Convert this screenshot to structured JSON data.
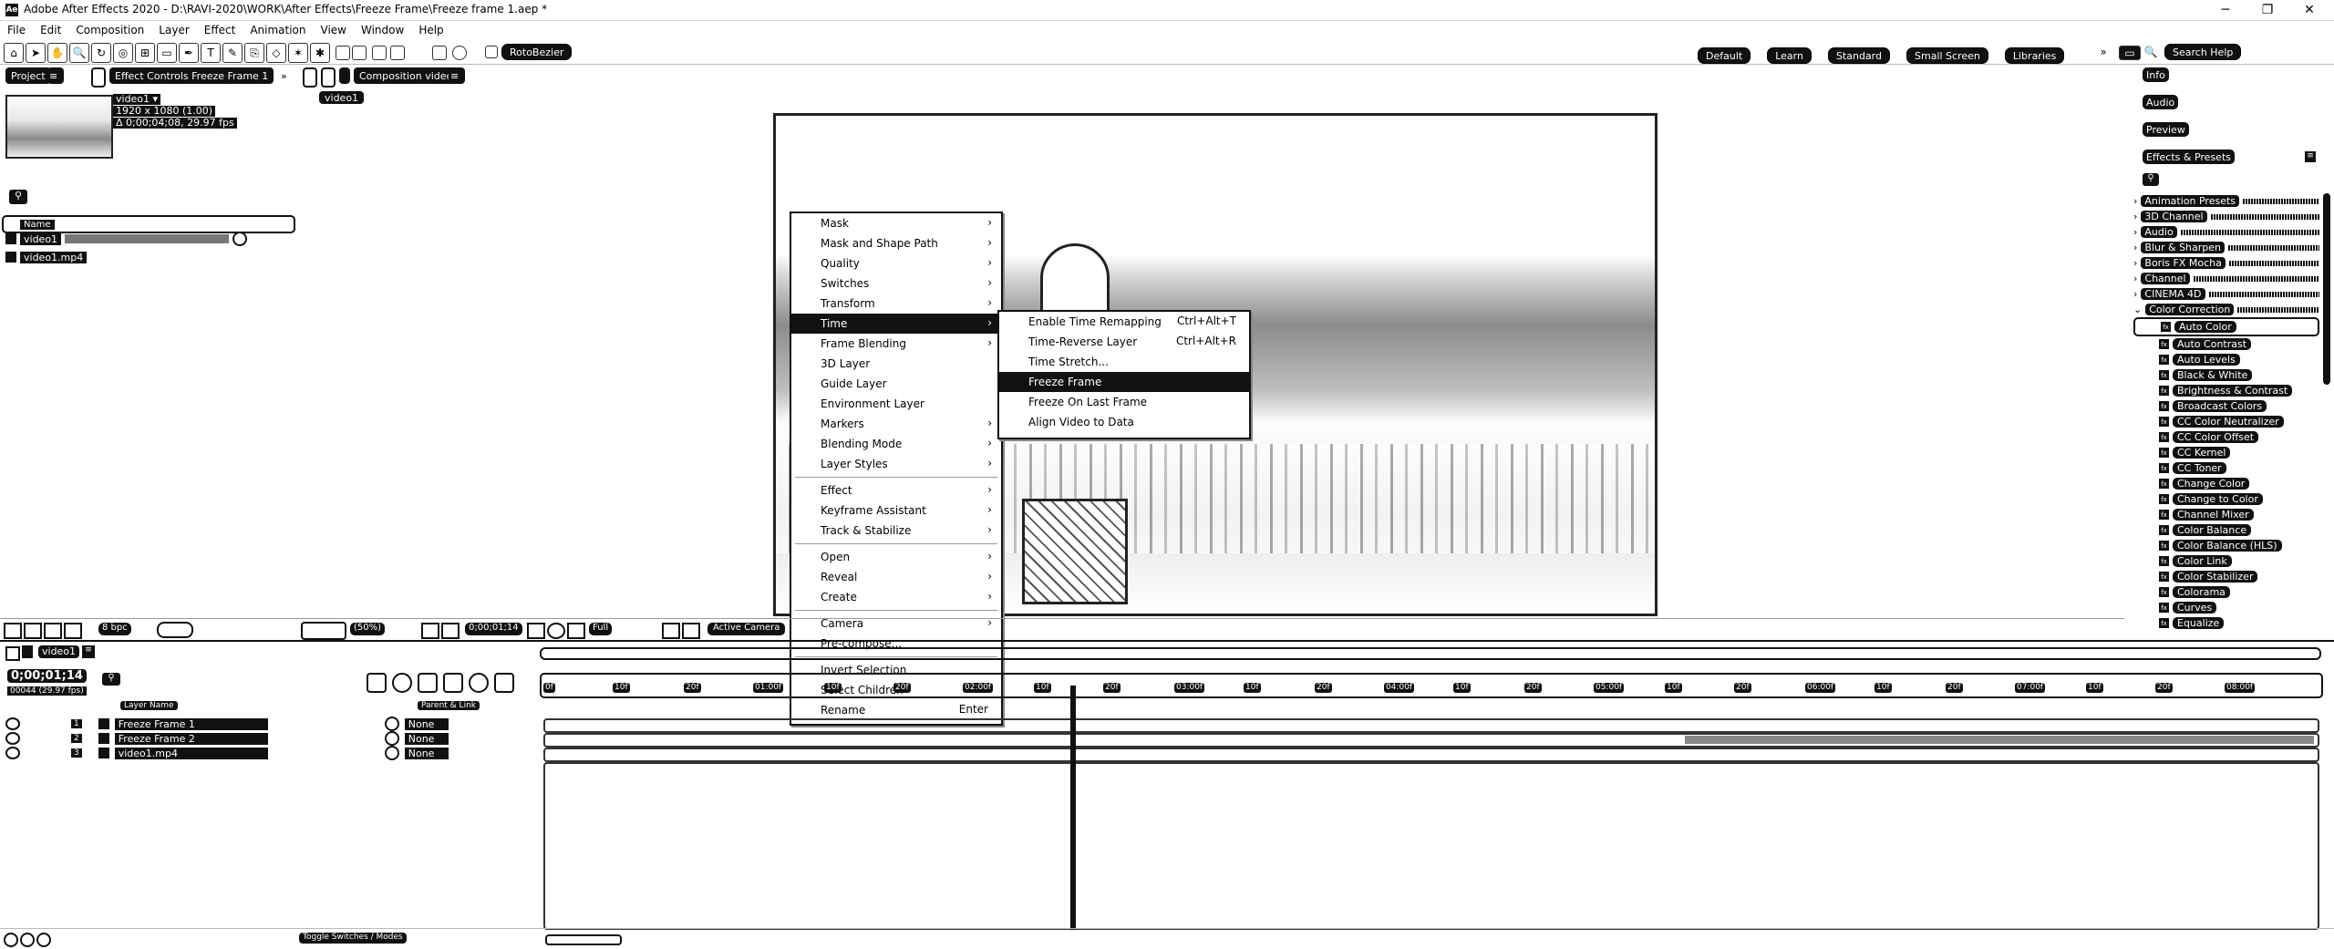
{
  "window": {
    "title": "Adobe After Effects 2020 - D:\\RAVI-2020\\WORK\\After Effects\\Freeze Frame\\Freeze frame 1.aep *",
    "app_badge": "Ae"
  },
  "menubar": [
    "File",
    "Edit",
    "Composition",
    "Layer",
    "Effect",
    "Animation",
    "View",
    "Window",
    "Help"
  ],
  "toolbar": {
    "roto_label": "RotoBezier",
    "workspaces": [
      "Default",
      "Learn",
      "Standard",
      "Small Screen",
      "Libraries"
    ],
    "search_help": "Search Help"
  },
  "panels": {
    "project_tab": "Project",
    "effect_controls_tab": "Effect Controls Freeze Frame 1",
    "composition_tab": "Composition video1",
    "comp_subtab": "video1"
  },
  "project": {
    "item_name": "video1 ▾",
    "item_info": [
      "1920 x 1080 (1.00)",
      "Δ 0;00;04;08, 29.97 fps"
    ],
    "name_header": "Name",
    "items": [
      "video1",
      "video1.mp4"
    ]
  },
  "viewer_toolbar": {
    "zoom": "(50%)",
    "timecode": "0;00;01;14",
    "resolution": "Full",
    "camera": "Active Camera",
    "bpc": "8 bpc"
  },
  "context_menu": {
    "items": [
      {
        "label": "Mask",
        "arrow": true
      },
      {
        "label": "Mask and Shape Path",
        "arrow": true
      },
      {
        "label": "Quality",
        "arrow": true
      },
      {
        "label": "Switches",
        "arrow": true
      },
      {
        "label": "Transform",
        "arrow": true
      },
      {
        "label": "Time",
        "arrow": true,
        "highlight": true
      },
      {
        "label": "Frame Blending",
        "arrow": true
      },
      {
        "label": "3D Layer",
        "arrow": false
      },
      {
        "label": "Guide Layer",
        "arrow": false
      },
      {
        "label": "Environment Layer",
        "arrow": false
      },
      {
        "label": "Markers",
        "arrow": true
      },
      {
        "label": "Blending Mode",
        "arrow": true
      },
      {
        "label": "Layer Styles",
        "arrow": true
      },
      {
        "sep": true
      },
      {
        "label": "Effect",
        "arrow": true
      },
      {
        "label": "Keyframe Assistant",
        "arrow": true
      },
      {
        "label": "Track & Stabilize",
        "arrow": true
      },
      {
        "sep": true
      },
      {
        "label": "Open",
        "arrow": true
      },
      {
        "label": "Reveal",
        "arrow": true
      },
      {
        "label": "Create",
        "arrow": true
      },
      {
        "sep": true
      },
      {
        "label": "Camera",
        "arrow": true
      },
      {
        "label": "Pre-compose...",
        "arrow": false
      },
      {
        "sep": true
      },
      {
        "label": "Invert Selection",
        "arrow": false
      },
      {
        "label": "Select Children",
        "arrow": false
      },
      {
        "label": "Rename",
        "arrow": false,
        "shortcut": "Enter"
      }
    ]
  },
  "time_submenu": {
    "items": [
      {
        "label": "Enable Time Remapping",
        "shortcut": "Ctrl+Alt+T"
      },
      {
        "label": "Time-Reverse Layer",
        "shortcut": "Ctrl+Alt+R"
      },
      {
        "label": "Time Stretch...",
        "shortcut": ""
      },
      {
        "label": "Freeze Frame",
        "shortcut": "",
        "highlight": true
      },
      {
        "label": "Freeze On Last Frame",
        "shortcut": ""
      },
      {
        "label": "Align Video to Data",
        "shortcut": ""
      }
    ]
  },
  "right_panel": {
    "links": [
      "Info",
      "Audio",
      "Preview",
      "Effects & Presets"
    ],
    "categories": [
      "Animation Presets",
      "3D Channel",
      "Audio",
      "Blur & Sharpen",
      "Boris FX Mocha",
      "Channel",
      "CINEMA 4D",
      "Color Correction"
    ],
    "effects": [
      "Auto Color",
      "Auto Contrast",
      "Auto Levels",
      "Black & White",
      "Brightness & Contrast",
      "Broadcast Colors",
      "CC Color Neutralizer",
      "CC Color Offset",
      "CC Kernel",
      "CC Toner",
      "Change Color",
      "Change to Color",
      "Channel Mixer",
      "Color Balance",
      "Color Balance (HLS)",
      "Color Link",
      "Color Stabilizer",
      "Colorama",
      "Curves",
      "Equalize"
    ]
  },
  "timeline": {
    "comp_tab": "video1",
    "timecode": "0;00;01;14",
    "fps_label": "00044 (29.97 fps)",
    "layer_name_header": "Layer Name",
    "parent_header": "Parent & Link",
    "ruler_ticks": [
      "0f",
      "10f",
      "20f",
      "01:00f",
      "10f",
      "20f",
      "02:00f",
      "10f",
      "20f",
      "03:00f",
      "10f",
      "20f",
      "04:00f",
      "10f",
      "20f",
      "05:00f",
      "10f",
      "20f",
      "06:00f",
      "10f",
      "20f",
      "07:00f",
      "10f",
      "20f",
      "08:00f"
    ],
    "layers": [
      {
        "num": "1",
        "name": "Freeze Frame 1",
        "parent": "None"
      },
      {
        "num": "2",
        "name": "Freeze Frame 2",
        "parent": "None"
      },
      {
        "num": "3",
        "name": "video1.mp4",
        "parent": "None"
      }
    ],
    "toggle_label": "Toggle Switches / Modes"
  }
}
